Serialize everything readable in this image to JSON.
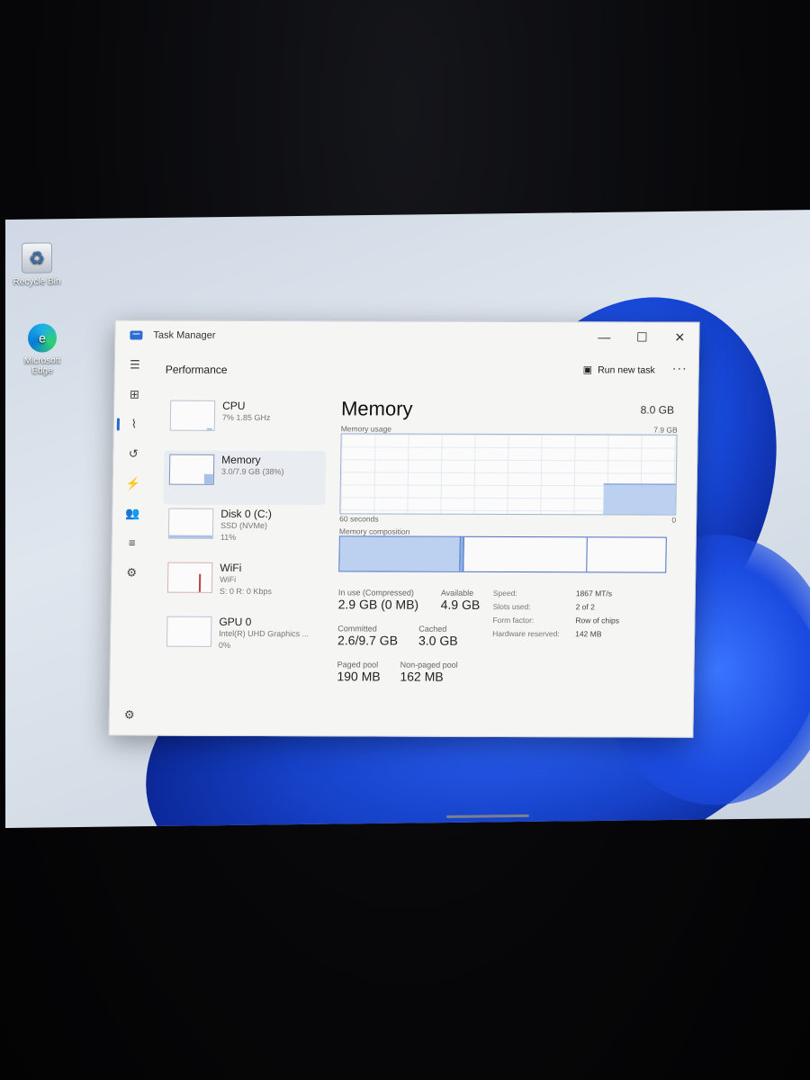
{
  "desktop": {
    "icons": [
      {
        "label": "Recycle Bin",
        "icon": "recycle-bin-icon"
      },
      {
        "label": "Microsoft Edge",
        "icon": "edge-icon"
      }
    ]
  },
  "window": {
    "title": "Task Manager",
    "controls": {
      "minimize": "—",
      "maximize": "☐",
      "close": "✕"
    }
  },
  "header": {
    "page_name": "Performance",
    "run_new_task": "Run new task",
    "more": "···"
  },
  "devices": [
    {
      "name": "CPU",
      "sub1": "7% 1.85 GHz",
      "sub2": "",
      "fill": 0.07
    },
    {
      "name": "Memory",
      "sub1": "3.0/7.9 GB (38%)",
      "sub2": "",
      "fill": 0.38
    },
    {
      "name": "Disk 0 (C:)",
      "sub1": "SSD (NVMe)",
      "sub2": "11%",
      "fill": 0.11
    },
    {
      "name": "WiFi",
      "sub1": "WiFi",
      "sub2": "S: 0 R: 0 Kbps",
      "fill": 0.0
    },
    {
      "name": "GPU 0",
      "sub1": "Intel(R) UHD Graphics ...",
      "sub2": "0%",
      "fill": 0.0
    }
  ],
  "memory": {
    "title": "Memory",
    "total": "8.0 GB",
    "usage_label": "Memory usage",
    "usage_max": "7.9 GB",
    "time_label": "60 seconds",
    "zero_label": "0",
    "usage_level": 0.38,
    "composition_label": "Memory composition",
    "composition": {
      "in_use": 0.37,
      "modified": 0.01,
      "standby": 0.38,
      "free": 0.24
    },
    "in_use_label": "In use (Compressed)",
    "in_use_value": "2.9 GB (0 MB)",
    "available_label": "Available",
    "available_value": "4.9 GB",
    "committed_label": "Committed",
    "committed_value": "2.6/9.7 GB",
    "cached_label": "Cached",
    "cached_value": "3.0 GB",
    "paged_label": "Paged pool",
    "paged_value": "190 MB",
    "nonpaged_label": "Non-paged pool",
    "nonpaged_value": "162 MB",
    "right_stats": [
      {
        "k": "Speed:",
        "v": "1867 MT/s"
      },
      {
        "k": "Slots used:",
        "v": "2 of 2"
      },
      {
        "k": "Form factor:",
        "v": "Row of chips"
      },
      {
        "k": "Hardware reserved:",
        "v": "142 MB"
      }
    ]
  },
  "colors": {
    "accent": "#2a66d1",
    "graph_fill": "#bcd0ef",
    "graph_border": "#4a6fc3"
  }
}
